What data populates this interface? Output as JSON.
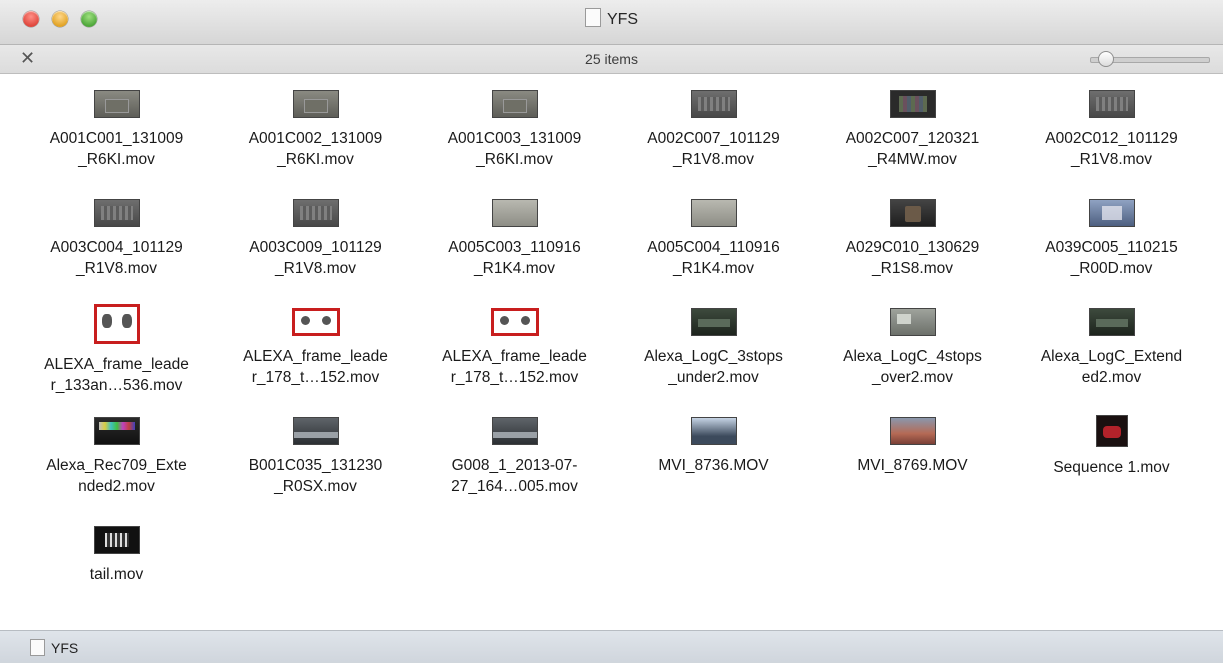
{
  "window": {
    "title": "YFS",
    "status": "25 items",
    "zoom_slider_level": 0.08
  },
  "files": [
    {
      "name": "A001C001_131009\n_R6KI.mov",
      "thumb": "gray"
    },
    {
      "name": "A001C002_131009\n_R6KI.mov",
      "thumb": "gray"
    },
    {
      "name": "A001C003_131009\n_R6KI.mov",
      "thumb": "gray"
    },
    {
      "name": "A002C007_101129\n_R1V8.mov",
      "thumb": "stone"
    },
    {
      "name": "A002C007_120321\n_R4MW.mov",
      "thumb": "colorchart"
    },
    {
      "name": "A002C012_101129\n_R1V8.mov",
      "thumb": "stone"
    },
    {
      "name": "A003C004_101129\n_R1V8.mov",
      "thumb": "stone"
    },
    {
      "name": "A003C009_101129\n_R1V8.mov",
      "thumb": "stone"
    },
    {
      "name": "A005C003_110916\n_R1K4.mov",
      "thumb": "light"
    },
    {
      "name": "A005C004_110916\n_R1K4.mov",
      "thumb": "light"
    },
    {
      "name": "A029C010_130629\n_R1S8.mov",
      "thumb": "dark"
    },
    {
      "name": "A039C005_110215\n_R00D.mov",
      "thumb": "blue"
    },
    {
      "name": "ALEXA_frame_leade\nr_133an…536.mov",
      "thumb": "leader"
    },
    {
      "name": "ALEXA_frame_leade\nr_178_t…152.mov",
      "thumb": "leader2"
    },
    {
      "name": "ALEXA_frame_leade\nr_178_t…152.mov",
      "thumb": "leader2"
    },
    {
      "name": "Alexa_LogC_3stops\n_under2.mov",
      "thumb": "green"
    },
    {
      "name": "Alexa_LogC_4stops\n_over2.mov",
      "thumb": "room"
    },
    {
      "name": "Alexa_LogC_Extend\ned2.mov",
      "thumb": "green"
    },
    {
      "name": "Alexa_Rec709_Exte\nnded2.mov",
      "thumb": "bars"
    },
    {
      "name": "B001C035_131230\n_R0SX.mov",
      "thumb": "road"
    },
    {
      "name": "G008_1_2013-07-\n27_164…005.mov",
      "thumb": "road"
    },
    {
      "name": "MVI_8736.MOV",
      "thumb": "sky"
    },
    {
      "name": "MVI_8769.MOV",
      "thumb": "crowd"
    },
    {
      "name": "Sequence 1.mov",
      "thumb": "red"
    },
    {
      "name": "tail.mov",
      "thumb": "tail"
    }
  ],
  "pathbar": {
    "item": "YFS"
  },
  "icons": {
    "close": "close-button",
    "minimize": "minimize-button",
    "zoom": "zoom-button",
    "toolbar": "action-icon"
  }
}
